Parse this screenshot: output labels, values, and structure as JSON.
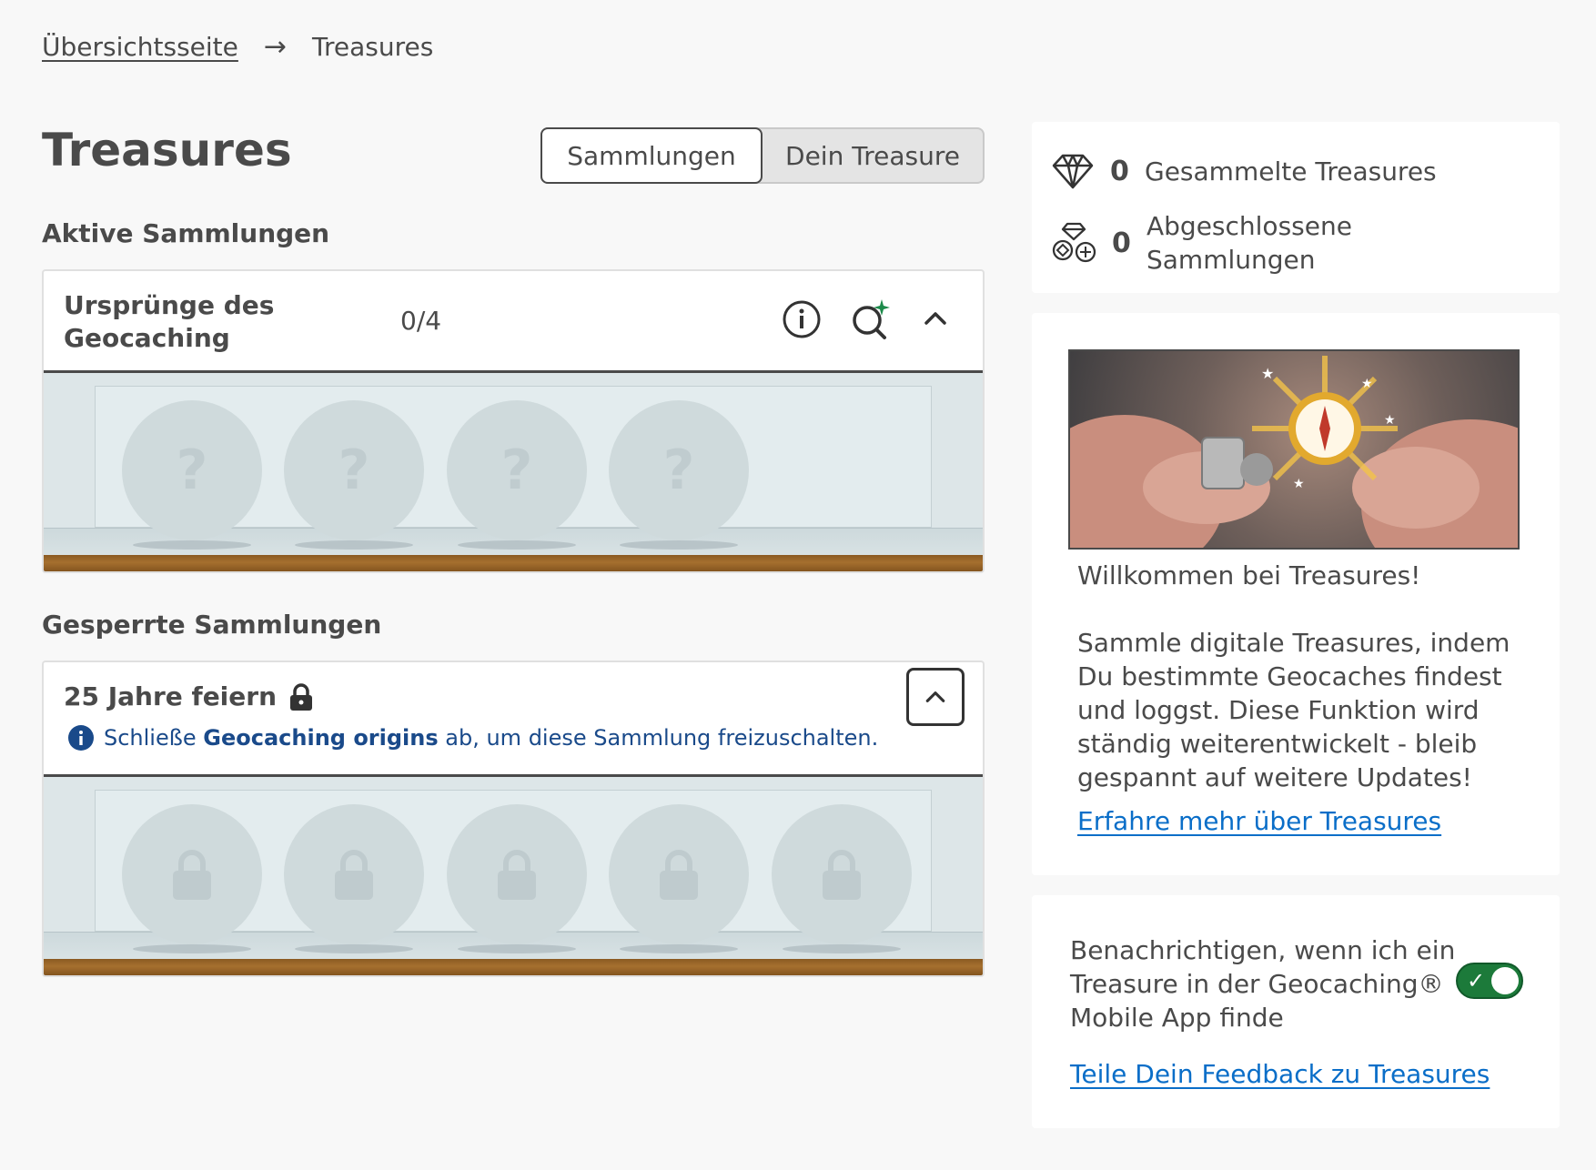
{
  "breadcrumb": {
    "home": "Übersichtsseite",
    "separator": "→",
    "current": "Treasures"
  },
  "page_title": "Treasures",
  "tabs": {
    "collections": "Sammlungen",
    "your_treasure": "Dein Treasure",
    "active": "collections"
  },
  "active_section": {
    "label": "Aktive Sammlungen",
    "collection": {
      "title_line1": "Ursprünge des",
      "title_line2": "Geocaching",
      "count": "0/4",
      "slot_glyph": "?",
      "slots": 4
    }
  },
  "locked_section": {
    "label": "Gesperrte Sammlungen",
    "collection": {
      "title": "25 Jahre feiern",
      "info_prefix": "Schließe ",
      "info_bold": "Geocaching origins",
      "info_suffix": " ab, um diese Sammlung freizuschalten.",
      "slots": 5
    }
  },
  "stats": {
    "collected_count": "0",
    "collected_label": "Gesammelte Treasures",
    "completed_count": "0",
    "completed_label_line1": "Abgeschlossene",
    "completed_label_line2": "Sammlungen"
  },
  "welcome": {
    "heading": "Willkommen bei Treasures!",
    "line1": "Sammle digitale Treasures, indem",
    "line2": "Du bestimmte Geocaches findest",
    "line3": "und loggst. Diese Funktion wird",
    "line4": "ständig weiterentwickelt - bleib",
    "line5": "gespannt auf weitere Updates!",
    "link": "Erfahre mehr über Treasures"
  },
  "notify": {
    "line1": "Benachrichtigen, wenn ich ein",
    "line2": "Treasure in der Geocaching®",
    "line3": "Mobile App finde",
    "toggle_on": true,
    "toggle_check": "✓",
    "feedback_link": "Teile Dein Feedback zu Treasures"
  },
  "colors": {
    "toggle_on": "#1c7a3a",
    "link": "#0a6ec8",
    "info_blue": "#1a4a8a",
    "sparkle": "#1c8a4a"
  }
}
